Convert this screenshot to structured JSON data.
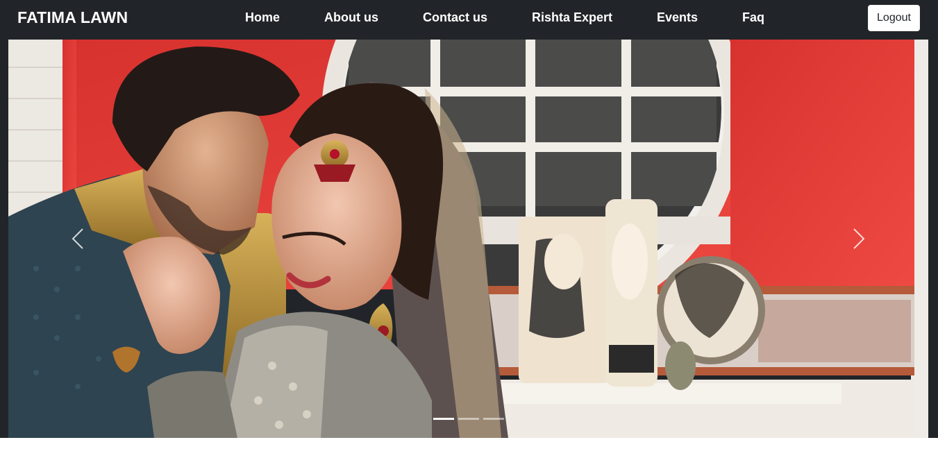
{
  "navbar": {
    "brand": "FATIMA LAWN",
    "links": [
      {
        "label": "Home"
      },
      {
        "label": "About us"
      },
      {
        "label": "Contact us"
      },
      {
        "label": "Rishta Expert"
      },
      {
        "label": "Events"
      },
      {
        "label": "Faq"
      }
    ],
    "logout_label": "Logout"
  },
  "carousel": {
    "active_slide": 1,
    "slide_count": 3,
    "prev_icon": "chevron-left-icon",
    "next_icon": "chevron-right-icon"
  },
  "colors": {
    "navbar_bg": "#212529",
    "wall_red": "#e8403b",
    "text_white": "#ffffff"
  }
}
